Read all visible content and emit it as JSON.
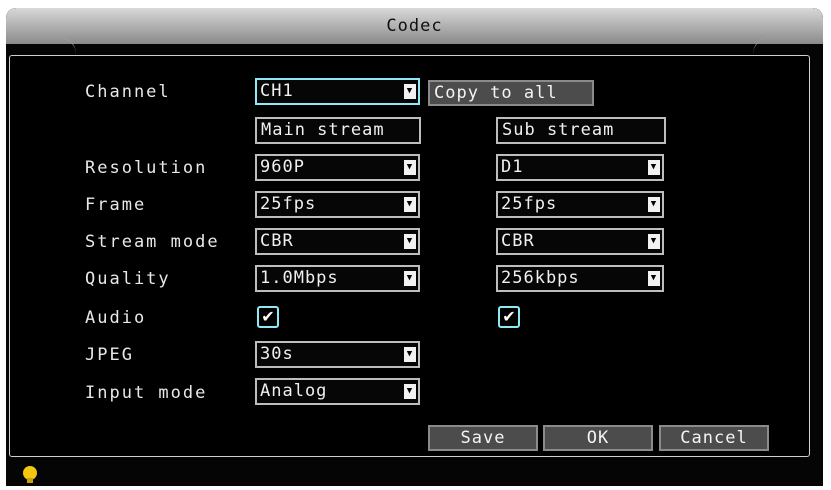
{
  "window": {
    "title": "Codec"
  },
  "header": {
    "channel_label": "Channel",
    "channel_value": "CH1",
    "copy_button": "Copy to all",
    "main_stream": "Main stream",
    "sub_stream": "Sub stream"
  },
  "rows": {
    "resolution": {
      "label": "Resolution",
      "main": "960P",
      "sub": "D1"
    },
    "frame": {
      "label": "Frame",
      "main": "25fps",
      "sub": "25fps"
    },
    "stream_mode": {
      "label": "Stream mode",
      "main": "CBR",
      "sub": "CBR"
    },
    "quality": {
      "label": "Quality",
      "main": "1.0Mbps",
      "sub": "256kbps"
    },
    "audio": {
      "label": "Audio",
      "main_checked": true,
      "sub_checked": true,
      "check_glyph": "✔"
    },
    "jpeg": {
      "label": "JPEG",
      "value": "30s"
    },
    "input_mode": {
      "label": "Input mode",
      "value": "Analog"
    }
  },
  "buttons": {
    "save": "Save",
    "ok": "OK",
    "cancel": "Cancel"
  },
  "colors": {
    "focus": "#8ee8f6",
    "background": "#050505",
    "bulb": "#f4c60f"
  },
  "icons": {
    "dropdown": "▼",
    "status": "lightbulb-icon"
  }
}
